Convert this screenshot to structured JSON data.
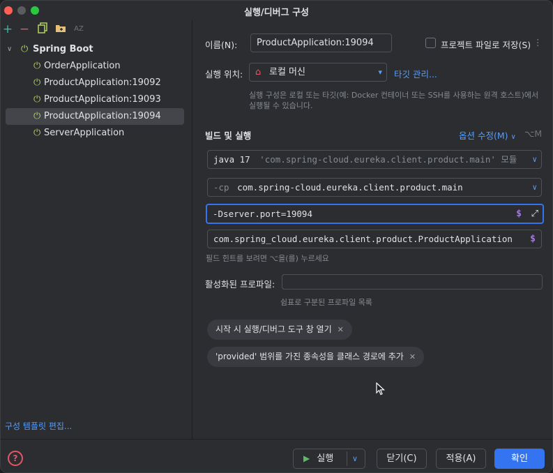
{
  "window": {
    "title": "실행/디버그 구성"
  },
  "sidebar": {
    "toolbar": [
      {
        "icon": "add-icon",
        "glyph": "+",
        "color": "#3fb6a6"
      },
      {
        "icon": "remove-icon",
        "glyph": "−",
        "color": "#e55765"
      },
      {
        "icon": "copy-icon",
        "glyph": "⧉",
        "color": "#b6d35e"
      },
      {
        "icon": "folder-icon",
        "glyph": "▭",
        "color": "#e5c07b"
      },
      {
        "icon": "sort-az-icon",
        "glyph": "AZ",
        "color": "#6f737a"
      }
    ],
    "group": {
      "label": "Spring Boot",
      "icon": "spring-boot-icon",
      "expanded": true
    },
    "items": [
      {
        "label": "OrderApplication",
        "selected": false
      },
      {
        "label": "ProductApplication:19092",
        "selected": false
      },
      {
        "label": "ProductApplication:19093",
        "selected": false
      },
      {
        "label": "ProductApplication:19094",
        "selected": true
      },
      {
        "label": "ServerApplication",
        "selected": false
      }
    ],
    "footer_link": "구성 템플릿 편집..."
  },
  "form": {
    "name_label": "이름(N):",
    "name_value": "ProductApplication:19094",
    "store_label": "프로젝트 파일로 저장(S)",
    "store_checked": false,
    "run_on_label": "실행 위치:",
    "run_on_value": "로컬 머신",
    "manage_targets": "타깃 관리...",
    "run_on_hint": "실행 구성은 로컬 또는 타깃(예: Docker 컨테이너 또는 SSH를 사용하는 원격 호스트)에서 실행될 수 있습니다.",
    "build_section": "빌드 및 실행",
    "modify_options": "옵션 수정(M)",
    "modify_shortcut": "⌥M",
    "jdk_label": "java 17",
    "jdk_module": "'com.spring-cloud.eureka.client.product.main' 모듈",
    "cp_prefix": "-cp",
    "cp_value": "com.spring-cloud.eureka.client.product.main",
    "vm_options": "-Dserver.port=19094",
    "main_class": "com.spring_cloud.eureka.client.product.ProductApplication",
    "build_hint": "필드 힌트를 보려면 ⌥을(를) 누르세요",
    "profiles_label": "활성화된 프로파일:",
    "profiles_value": "",
    "profiles_hint": "쉼표로 구분된 프로파일 목록",
    "chips": [
      {
        "label": "시작 시 실행/디버그 도구 창 열기"
      },
      {
        "label": "'provided' 범위를 가진 종속성을 클래스 경로에 추가"
      }
    ]
  },
  "footer": {
    "run_label": "실행",
    "close_label": "닫기(C)",
    "apply_label": "적용(A)",
    "ok_label": "확인",
    "help_glyph": "?"
  }
}
